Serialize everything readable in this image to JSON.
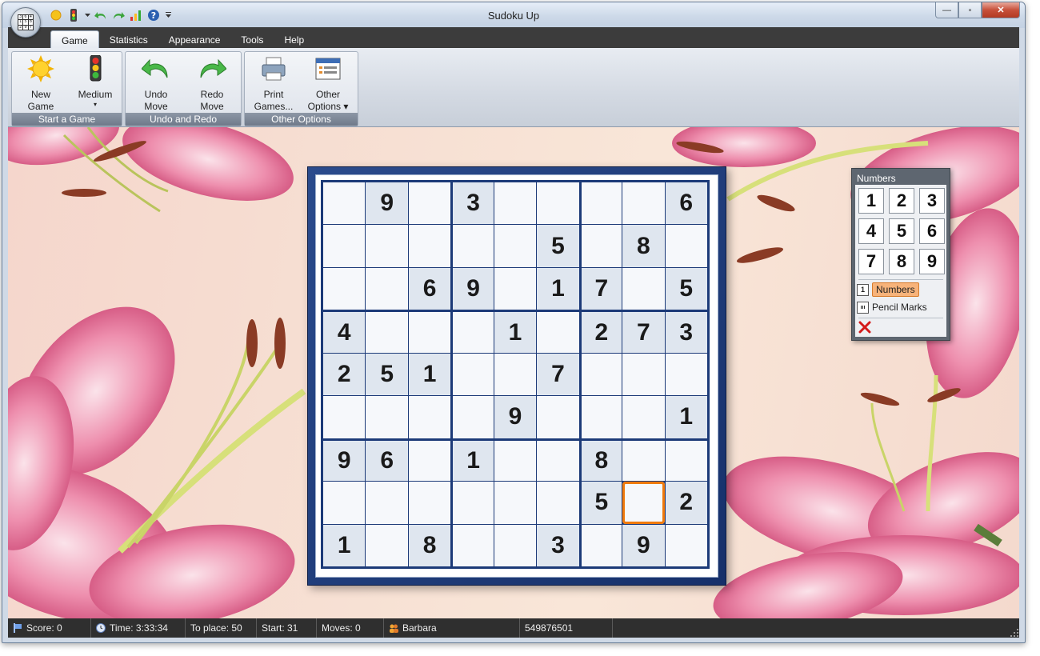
{
  "window": {
    "title": "Sudoku Up"
  },
  "title_controls": {
    "minimize": "—",
    "maximize": "▫",
    "close": "✕"
  },
  "quick_access": [
    "new-game",
    "difficulty",
    "undo",
    "redo",
    "statistics",
    "help",
    "customize"
  ],
  "tabs": [
    "Game",
    "Statistics",
    "Appearance",
    "Tools",
    "Help"
  ],
  "ribbon": {
    "groups": [
      {
        "label": "Start a Game",
        "buttons": [
          {
            "line1": "New",
            "line2": "Game",
            "icon": "sun-icon"
          },
          {
            "line1": "Medium",
            "line2": "▾",
            "icon": "traffic-light-icon"
          }
        ]
      },
      {
        "label": "Undo and Redo",
        "buttons": [
          {
            "line1": "Undo",
            "line2": "Move",
            "icon": "undo-icon"
          },
          {
            "line1": "Redo",
            "line2": "Move",
            "icon": "redo-icon"
          }
        ]
      },
      {
        "label": "Other Options",
        "buttons": [
          {
            "line1": "Print",
            "line2": "Games...",
            "icon": "printer-icon"
          },
          {
            "line1": "Other",
            "line2": "Options ▾",
            "icon": "options-icon"
          }
        ]
      }
    ]
  },
  "board": {
    "rows": [
      [
        "",
        "9",
        "",
        "3",
        "",
        "",
        "",
        "",
        "6"
      ],
      [
        "",
        "",
        "",
        "",
        "",
        "5",
        "",
        "8",
        ""
      ],
      [
        "",
        "",
        "6",
        "9",
        "",
        "1",
        "7",
        "",
        "5"
      ],
      [
        "4",
        "",
        "",
        "",
        "1",
        "",
        "2",
        "7",
        "3"
      ],
      [
        "2",
        "5",
        "1",
        "",
        "",
        "7",
        "",
        "",
        ""
      ],
      [
        "",
        "",
        "",
        "",
        "9",
        "",
        "",
        "",
        "1"
      ],
      [
        "9",
        "6",
        "",
        "1",
        "",
        "",
        "8",
        "",
        ""
      ],
      [
        "",
        "",
        "",
        "",
        "",
        "",
        "5",
        "",
        "2"
      ],
      [
        "1",
        "",
        "8",
        "",
        "",
        "3",
        "",
        "9",
        ""
      ]
    ],
    "selected": {
      "row": 7,
      "col": 7
    }
  },
  "numbers_panel": {
    "title": "Numbers",
    "keys": [
      "1",
      "2",
      "3",
      "4",
      "5",
      "6",
      "7",
      "8",
      "9"
    ],
    "modes": [
      {
        "label": "Numbers",
        "badge": "1",
        "active": true
      },
      {
        "label": "Pencil Marks",
        "badge": "ııı",
        "active": false
      }
    ],
    "clear_icon": "red-x-icon"
  },
  "statusbar": {
    "score": "Score: 0",
    "time": "Time: 3:33:34",
    "to_place": "To place: 50",
    "start": "Start: 31",
    "moves": "Moves: 0",
    "player": "Barbara",
    "game_id": "549876501"
  },
  "colors": {
    "selection": "#f07a0c",
    "grid_line": "#1c3a78",
    "given_cell": "#dfe6ef",
    "panel": "#5e6670"
  }
}
